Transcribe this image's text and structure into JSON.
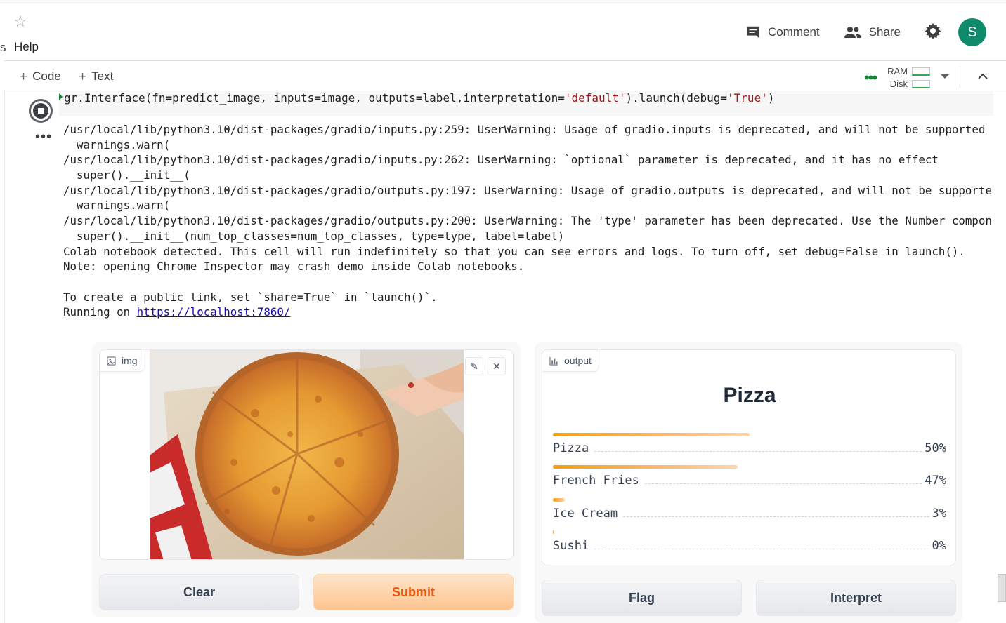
{
  "header": {
    "left_fragment": "s",
    "menu_help": "Help",
    "comment_label": "Comment",
    "share_label": "Share",
    "avatar_letter": "S"
  },
  "toolbar": {
    "add_code": "Code",
    "add_text": "Text",
    "ram_label": "RAM",
    "disk_label": "Disk"
  },
  "cell": {
    "code_prefix": "gr.Interface(fn=predict_image, inputs=image, outputs=label,interpretation=",
    "code_str1": "'default'",
    "code_mid": ").launch(debug=",
    "code_str2": "'True'",
    "code_suffix": ")",
    "output_lines": [
      "/usr/local/lib/python3.10/dist-packages/gradio/inputs.py:259: UserWarning: Usage of gradio.inputs is deprecated, and will not be supported",
      "  warnings.warn(",
      "/usr/local/lib/python3.10/dist-packages/gradio/inputs.py:262: UserWarning: `optional` parameter is deprecated, and it has no effect",
      "  super().__init__(",
      "/usr/local/lib/python3.10/dist-packages/gradio/outputs.py:197: UserWarning: Usage of gradio.outputs is deprecated, and will not be supported",
      "  warnings.warn(",
      "/usr/local/lib/python3.10/dist-packages/gradio/outputs.py:200: UserWarning: The 'type' parameter has been deprecated. Use the Number component",
      "  super().__init__(num_top_classes=num_top_classes, type=type, label=label)",
      "Colab notebook detected. This cell will run indefinitely so that you can see errors and logs. To turn off, set debug=False in launch().",
      "Note: opening Chrome Inspector may crash demo inside Colab notebooks.",
      "",
      "To create a public link, set `share=True` in `launch()`."
    ],
    "running_prefix": "Running on ",
    "running_url": "https://localhost:7860/"
  },
  "gradio": {
    "input_label": "img",
    "output_label": "output",
    "prediction": "Pizza",
    "confidences": [
      {
        "label": "Pizza",
        "value": 0.5,
        "display": "50%"
      },
      {
        "label": "French Fries",
        "value": 0.47,
        "display": "47%"
      },
      {
        "label": "Ice Cream",
        "value": 0.03,
        "display": "3%"
      },
      {
        "label": "Sushi",
        "value": 0.0,
        "display": "0%"
      }
    ],
    "buttons": {
      "clear": "Clear",
      "submit": "Submit",
      "flag": "Flag",
      "interpret": "Interpret"
    }
  },
  "colors": {
    "accent_orange": "#ea580c",
    "avatar_bg": "#0f8a6b",
    "ram_ok": "#34a853"
  }
}
